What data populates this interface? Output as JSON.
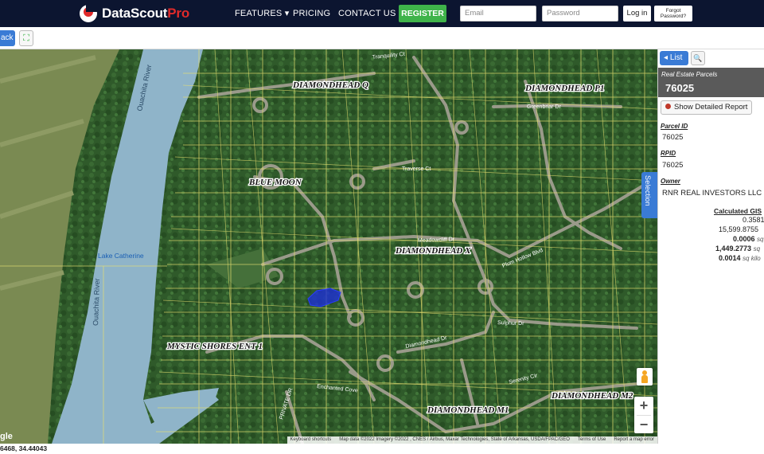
{
  "header": {
    "logo_main": "DataScout",
    "logo_accent": "Pro",
    "nav": [
      {
        "label": "FEATURES ▾"
      },
      {
        "label": "PRICING"
      },
      {
        "label": "CONTACT US"
      }
    ],
    "register_label": "REGISTER",
    "email_placeholder": "Email",
    "password_placeholder": "Password",
    "login_label": "Log in",
    "forgot_label_1": "Forgot",
    "forgot_label_2": "Password?"
  },
  "toolbar": {
    "back_label": "ack"
  },
  "map": {
    "labels": [
      {
        "text": "DIAMONDHEAD Q"
      },
      {
        "text": "DIAMONDHEAD P1"
      },
      {
        "text": "BLUE MOON"
      },
      {
        "text": "DIAMONDHEAD X"
      },
      {
        "text": "MYSTIC SHORES ENT 1"
      },
      {
        "text": "DIAMONDHEAD M2"
      },
      {
        "text": "DIAMONDHEAD M1"
      },
      {
        "text": "Lake Catherine"
      },
      {
        "text": "Ouachita River"
      },
      {
        "text": "Ouachita River"
      },
      {
        "text": "Meadowcliff Dr"
      },
      {
        "text": "Traverse Ct"
      },
      {
        "text": "Greenbriar Dr"
      },
      {
        "text": "Diamondhead Dr"
      },
      {
        "text": "Enchanted Cove"
      },
      {
        "text": "Serenity Cir"
      },
      {
        "text": "Sulphur Dr"
      },
      {
        "text": "PRIVATE DR"
      },
      {
        "text": "Plum Hollow Blvd"
      },
      {
        "text": "Tranquility Ct"
      }
    ],
    "google_partial": "gle",
    "attribution": {
      "shortcuts": "Keyboard shortcuts",
      "data": "Map data ©2022 Imagery ©2022 , CNES / Airbus, Maxar Technologies, State of Arkansas, USDA/FPAC/GEO",
      "terms": "Terms of Use",
      "report": "Report a map error"
    },
    "zoom_in": "+",
    "zoom_out": "−",
    "selection_tab": "Selection"
  },
  "panel": {
    "list_label": "List",
    "category": "Real Estate Parcels",
    "parcel_title": "76025",
    "report_button": "Show Detailed Report",
    "fields": [
      {
        "label": "Parcel ID",
        "value": "76025"
      },
      {
        "label": "RPID",
        "value": "76025"
      },
      {
        "label": "Owner",
        "value": "RNR REAL INVESTORS LLC"
      }
    ],
    "calc_title": "Calculated GIS",
    "calc_rows": [
      {
        "value": "0.3581",
        "unit": ""
      },
      {
        "value": "15,599.8755",
        "unit": ""
      },
      {
        "value": "0.0006",
        "unit": "sq"
      },
      {
        "value": "1,449.2773",
        "unit": "sq"
      },
      {
        "value": "0.0014",
        "unit": "sq kilo"
      }
    ]
  },
  "status": {
    "coords": "6468, 34.44043"
  },
  "colors": {
    "header_bg": "#0c1530",
    "accent_blue": "#3a7bd5",
    "register_green": "#3fb34a",
    "logo_red": "#e02a2a",
    "parcel_line": "#e8e070",
    "selected_parcel": "#1e2fd6",
    "water": "#8fb4c9"
  }
}
